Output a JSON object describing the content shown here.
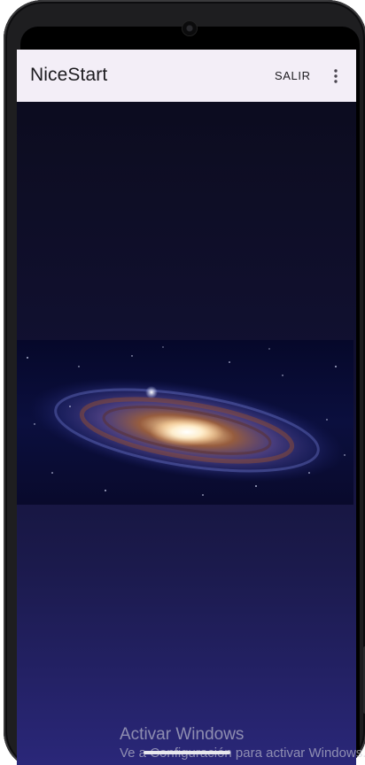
{
  "app_bar": {
    "title": "NiceStart",
    "action_label": "SALIR",
    "overflow_icon": "more-vert-icon"
  },
  "content": {
    "image": "galaxy-image"
  },
  "windows_watermark": {
    "title": "Activar Windows",
    "subtitle": "Ve a Configuración para activar Windows."
  },
  "colors": {
    "app_bar_background": "#f3eef7",
    "content_top": "#0c0c1f",
    "content_bottom": "#2a2779"
  }
}
